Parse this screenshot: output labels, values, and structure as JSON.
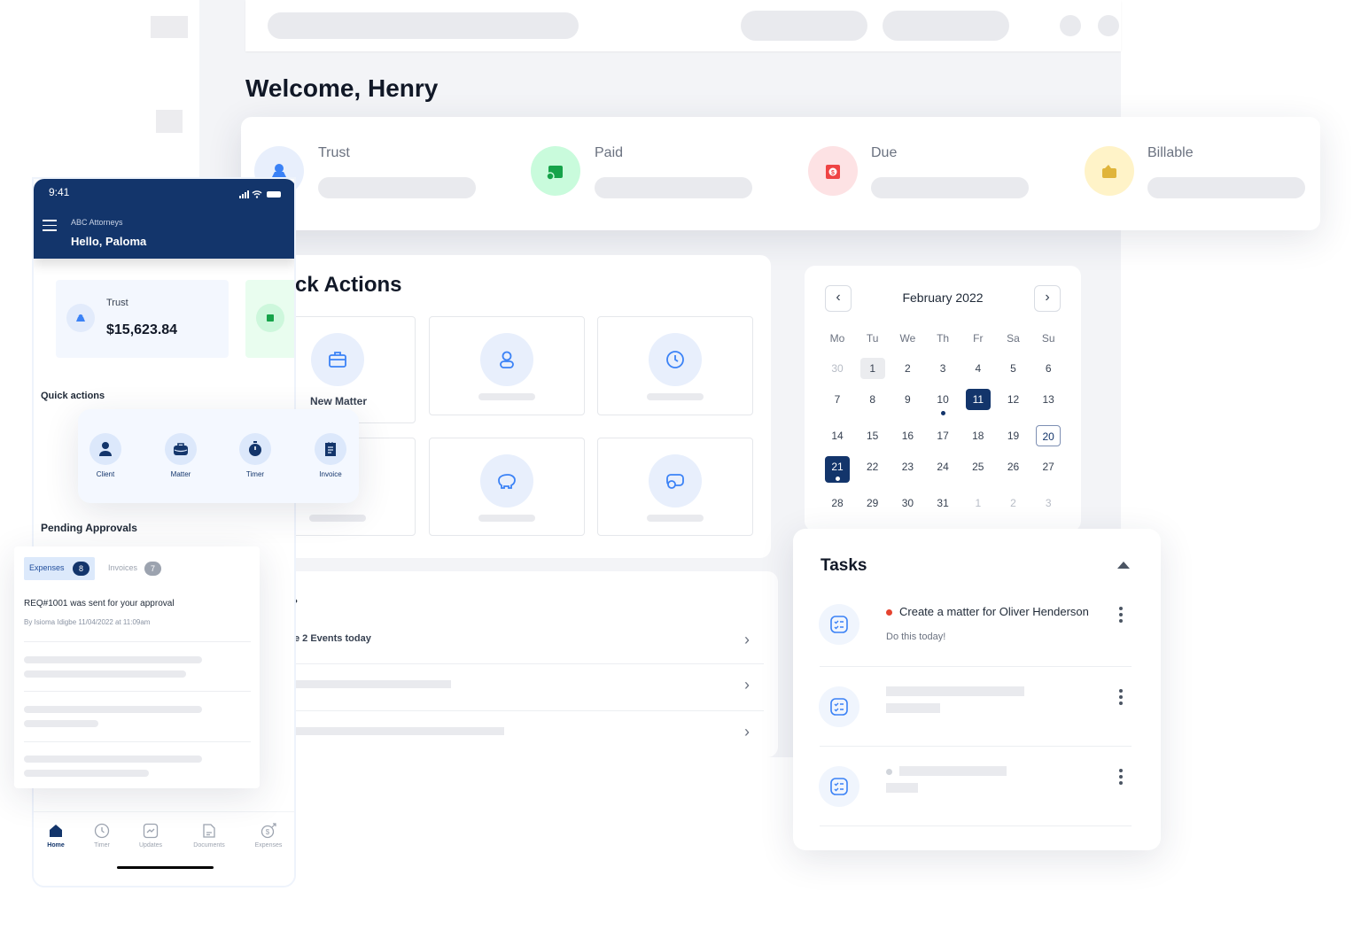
{
  "desktop": {
    "welcome": "Welcome, Henry",
    "stats": [
      {
        "label": "Trust",
        "icon": "trust-icon",
        "color": "#3b82f6",
        "bg": "#e8effc"
      },
      {
        "label": "Paid",
        "icon": "wallet-check-icon",
        "color": "#16a34a",
        "bg": "#c9fbdc"
      },
      {
        "label": "Due",
        "icon": "calendar-dollar-icon",
        "color": "#ef4444",
        "bg": "#fde2e4"
      },
      {
        "label": "Billable",
        "icon": "wallet-icon",
        "color": "#e0b43a",
        "bg": "#fff3c8"
      }
    ],
    "quick_actions": {
      "title": "ck Actions",
      "tiles": [
        {
          "label": "New Matter",
          "icon": "briefcase-icon"
        },
        {
          "label": "",
          "icon": "user-icon"
        },
        {
          "label": "",
          "icon": "clock-icon"
        },
        {
          "label": "",
          "icon": "document-icon"
        },
        {
          "label": "",
          "icon": "piggy-bank-icon"
        },
        {
          "label": "",
          "icon": "money-icon"
        }
      ]
    },
    "events": {
      "title_fragment": "›",
      "rows": [
        {
          "label": "e 2 Events today"
        },
        {
          "label": ""
        },
        {
          "label": ""
        }
      ]
    },
    "calendar": {
      "month": "February 2022",
      "weekdays": [
        "Mo",
        "Tu",
        "We",
        "Th",
        "Fr",
        "Sa",
        "Su"
      ],
      "weeks": [
        [
          "30",
          "1",
          "2",
          "3",
          "4",
          "5",
          "6"
        ],
        [
          "7",
          "8",
          "9",
          "10",
          "11",
          "12",
          "13"
        ],
        [
          "14",
          "15",
          "16",
          "17",
          "18",
          "19",
          "20"
        ],
        [
          "21",
          "22",
          "23",
          "24",
          "25",
          "26",
          "27"
        ],
        [
          "28",
          "29",
          "30",
          "31",
          "1",
          "2",
          "3"
        ]
      ],
      "selected": [
        "11",
        "21"
      ],
      "today": "20",
      "event_days": [
        "10",
        "21"
      ]
    },
    "tasks": {
      "title": "Tasks",
      "items": [
        {
          "title": "Create a matter for Oliver Henderson",
          "subtitle": "Do this today!",
          "status_color": "#e5432f"
        }
      ]
    }
  },
  "mobile": {
    "time": "9:41",
    "firm": "ABC Attorneys",
    "greeting": "Hello, Paloma",
    "trust_label": "Trust",
    "trust_value": "$15,623.84",
    "quick_actions_title": "Quick actions",
    "quick_actions": [
      {
        "label": "Client",
        "icon": "user-icon"
      },
      {
        "label": "Matter",
        "icon": "briefcase-icon"
      },
      {
        "label": "Timer",
        "icon": "stopwatch-icon"
      },
      {
        "label": "Invoice",
        "icon": "invoice-icon"
      }
    ],
    "pending_title": "Pending Approvals",
    "tabs": [
      {
        "label": "Expenses",
        "count": "8"
      },
      {
        "label": "Invoices",
        "count": "7"
      }
    ],
    "approval": {
      "title": "REQ#1001 was sent for your approval",
      "meta": "By Isioma Idigbe 11/04/2022 at 11:09am"
    },
    "nav": [
      {
        "label": "Home",
        "icon": "home-icon"
      },
      {
        "label": "Timer",
        "icon": "clock-icon"
      },
      {
        "label": "Updates",
        "icon": "chart-icon"
      },
      {
        "label": "Documents",
        "icon": "document-icon"
      },
      {
        "label": "Expenses",
        "icon": "expenses-icon"
      }
    ],
    "brand_color": "#13356b"
  }
}
